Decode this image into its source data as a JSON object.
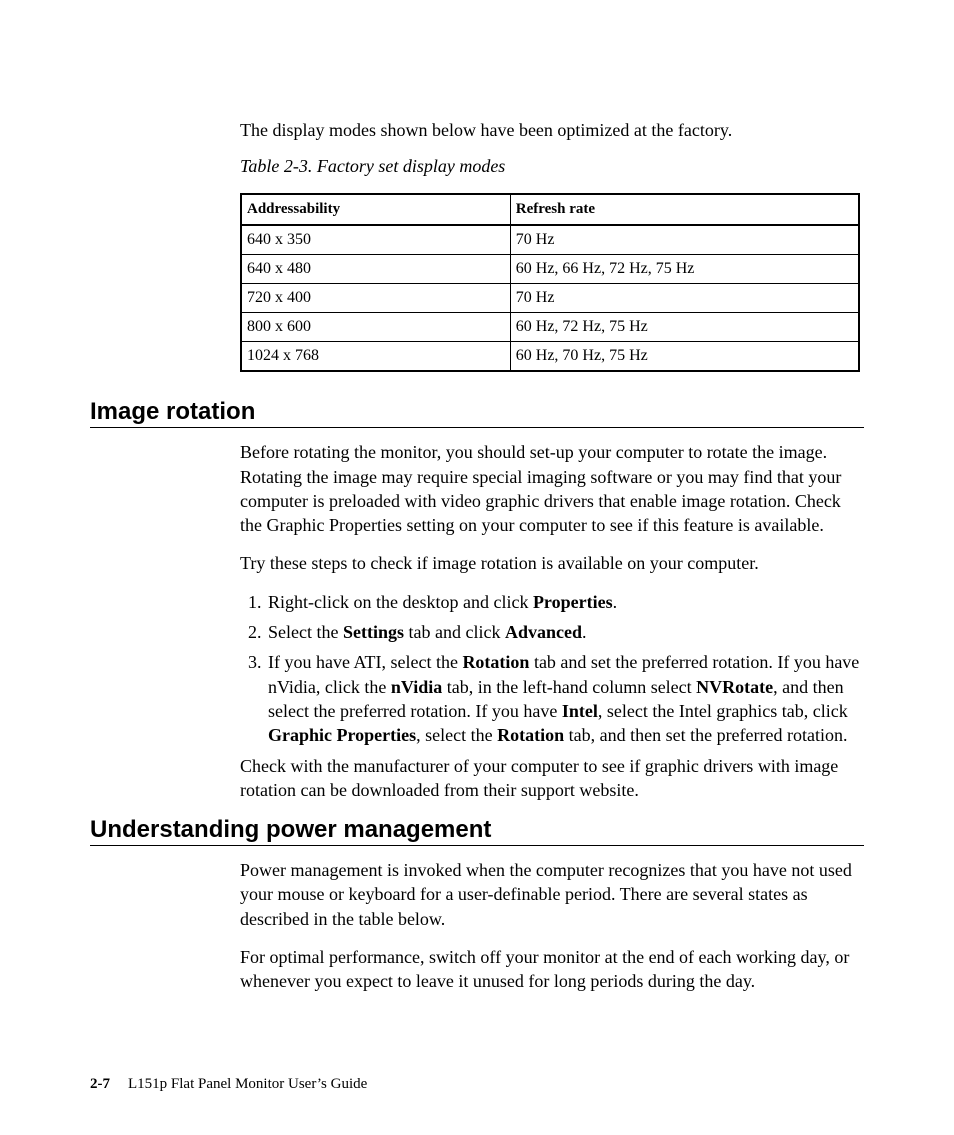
{
  "intro": "The display modes shown below have been optimized at the factory.",
  "table": {
    "caption": "Table 2-3. Factory set display modes",
    "headers": {
      "col1": "Addressability",
      "col2": "Refresh rate"
    },
    "rows": [
      {
        "c1": "640 x 350",
        "c2": "70 Hz"
      },
      {
        "c1": "640 x 480",
        "c2": "60 Hz, 66 Hz, 72 Hz, 75 Hz"
      },
      {
        "c1": "720 x 400",
        "c2": "70 Hz"
      },
      {
        "c1": "800 x 600",
        "c2": "60 Hz, 72 Hz, 75 Hz"
      },
      {
        "c1": "1024 x 768",
        "c2": "60 Hz, 70 Hz, 75 Hz"
      }
    ]
  },
  "section1": {
    "heading": "Image rotation",
    "p1": "Before rotating the monitor, you should set-up your computer to rotate the image. Rotating the image may require special imaging software or you may find that your computer is preloaded with video graphic drivers that enable image rotation. Check the Graphic Properties setting on your computer to see if this feature is available.",
    "p2": "Try these steps to check if image rotation is available on your computer.",
    "step1": {
      "pre": "Right-click on the desktop and click ",
      "b1": "Properties",
      "post": "."
    },
    "step2": {
      "pre": "Select the ",
      "b1": "Settings",
      "mid": " tab and click ",
      "b2": "Advanced",
      "post": "."
    },
    "step3": {
      "t1": "If you have ATI, select the ",
      "b1": "Rotation",
      "t2": " tab and set the preferred rotation. If you have nVidia, click the ",
      "b2": "nVidia",
      "t3": " tab, in the left-hand column select ",
      "b3": "NVRotate",
      "t4": ", and then select the preferred rotation. If you have ",
      "b4": "Intel",
      "t5": ", select the Intel graphics tab, click ",
      "b5": "Graphic Properties",
      "t6": ", select the ",
      "b6": "Rotation",
      "t7": " tab, and then set the preferred rotation."
    },
    "p3": "Check with the manufacturer of your computer to see if graphic drivers with image rotation can be downloaded from their support website."
  },
  "section2": {
    "heading": "Understanding power management",
    "p1": "Power management is invoked when the computer recognizes that you have not used your mouse or keyboard for a user-definable period. There are several states as described in the table below.",
    "p2": "For optimal performance, switch off your monitor at the end of each working day, or whenever you expect to leave it unused for long periods during the day."
  },
  "footer": {
    "pageno": "2-7",
    "guide": "L151p Flat Panel Monitor User’s Guide"
  }
}
